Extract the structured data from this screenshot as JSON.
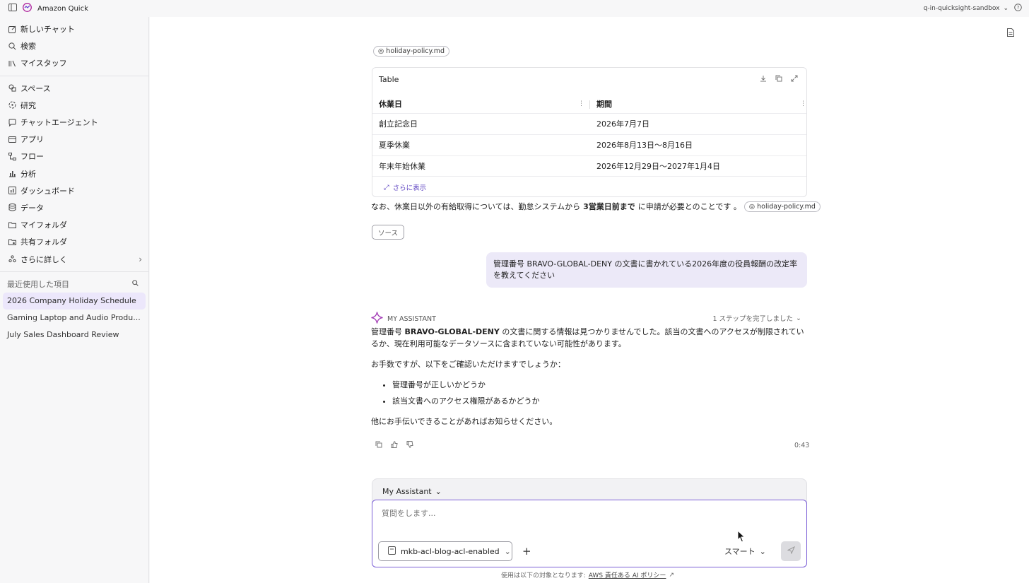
{
  "app": {
    "title": "Amazon Quick",
    "account": "q-in-quicksight-sandbox"
  },
  "sidebar": {
    "group1": [
      {
        "label": "新しいチャット",
        "icon": "edit-icon"
      },
      {
        "label": "検索",
        "icon": "search-icon"
      },
      {
        "label": "マイスタッフ",
        "icon": "library-icon"
      }
    ],
    "group2": [
      {
        "label": "スペース",
        "icon": "spaces-icon"
      },
      {
        "label": "研究",
        "icon": "research-icon"
      },
      {
        "label": "チャットエージェント",
        "icon": "chat-agent-icon"
      },
      {
        "label": "アプリ",
        "icon": "app-icon"
      },
      {
        "label": "フロー",
        "icon": "flow-icon"
      },
      {
        "label": "分析",
        "icon": "analysis-icon"
      },
      {
        "label": "ダッシュボード",
        "icon": "dashboard-icon"
      },
      {
        "label": "データ",
        "icon": "database-icon"
      },
      {
        "label": "マイフォルダ",
        "icon": "folder-icon"
      },
      {
        "label": "共有フォルダ",
        "icon": "shared-folder-icon"
      },
      {
        "label": "さらに詳しく",
        "icon": "more-icon"
      }
    ],
    "recent_title": "最近使用した項目",
    "recent": [
      "2026 Company Holiday Schedule",
      "Gaming Laptop and Audio Produ...",
      "July Sales Dashboard Review"
    ]
  },
  "chat": {
    "top_chip": "holiday-policy.md",
    "table": {
      "title": "Table",
      "headers": [
        "休業日",
        "期間"
      ],
      "rows": [
        [
          "創立記念日",
          "2026年7月7日"
        ],
        [
          "夏季休業",
          "2026年8月13日～8月16日"
        ],
        [
          "年末年始休業",
          "2026年12月29日～2027年1月4日"
        ]
      ],
      "more_label": "さらに表示"
    },
    "note": {
      "pre": "なお、休業日以外の有給取得については、勤怠システムから",
      "bold": "3営業日前まで",
      "post": "に申請が必要とのことです 。",
      "chip": "holiday-policy.md"
    },
    "source_btn": "ソース",
    "user_message": "管理番号 BRAVO-GLOBAL-DENY の文書に書かれている2026年度の役員報酬の改定率を教えてください",
    "assistant": {
      "name": "MY ASSISTANT",
      "steps": "1 ステップを完了しました",
      "p1_pre": "管理番号 ",
      "p1_bold": "BRAVO-GLOBAL-DENY",
      "p1_post": " の文書に関する情報は見つかりませんでした。該当の文書へのアクセスが制限されているか、現在利用可能なデータソースに含まれていない可能性があります。",
      "p2": "お手数ですが、以下をご確認いただけますでしょうか：",
      "bullets": [
        "管理番号が正しいかどうか",
        "該当文書へのアクセス権限があるかどうか"
      ],
      "p3": "他にお手伝いできることがあればお知らせください。",
      "time": "0:43"
    }
  },
  "composer": {
    "agent": "My Assistant",
    "placeholder": "質問をします...",
    "datasource": "mkb-acl-blog-acl-enabled",
    "mode": "スマート"
  },
  "footer": {
    "text": "使用は以下の対象となります:",
    "link": "AWS 責任ある AI ポリシー"
  },
  "colors": {
    "accent": "#7b5fd6",
    "bubble": "#ece9f8",
    "active": "#ece7fb"
  }
}
